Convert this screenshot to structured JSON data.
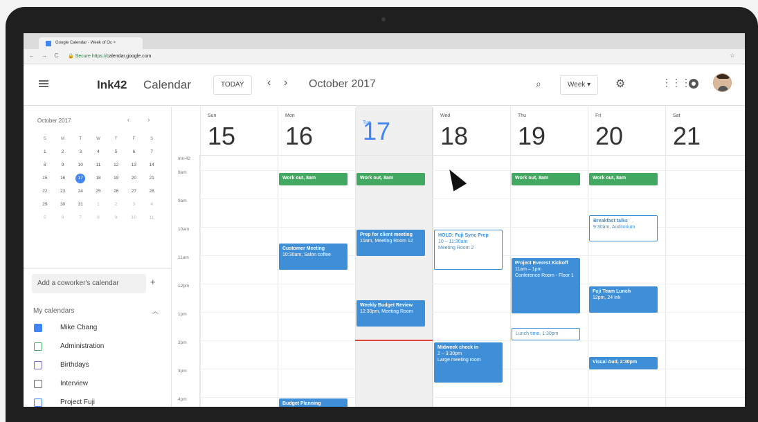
{
  "browser": {
    "tab_title": "Google Calendar - Week of Oc ×",
    "secure": "Secure",
    "url_prefix": "https://",
    "url_host": "calendar.google.com"
  },
  "header": {
    "brand": "Ink42",
    "app": "Calendar",
    "today_btn": "TODAY",
    "period": "October 2017",
    "view": "Week ▾"
  },
  "sidebar": {
    "mini_title": "October 2017",
    "mini_nav": "‹ ›",
    "weekday_heads": [
      "S",
      "M",
      "T",
      "W",
      "T",
      "F",
      "S"
    ],
    "days": [
      [
        "1",
        "2",
        "3",
        "4",
        "5",
        "6",
        "7"
      ],
      [
        "8",
        "9",
        "10",
        "11",
        "12",
        "13",
        "14"
      ],
      [
        "15",
        "16",
        "17",
        "18",
        "19",
        "20",
        "21"
      ],
      [
        "22",
        "23",
        "24",
        "25",
        "26",
        "27",
        "28"
      ],
      [
        "29",
        "30",
        "31",
        "1",
        "2",
        "3",
        "4"
      ],
      [
        "5",
        "6",
        "7",
        "8",
        "9",
        "10",
        "11"
      ]
    ],
    "add_placeholder": "Add a coworker's calendar",
    "my_calendars": "My calendars",
    "calendars": [
      "Mike Chang",
      "Administration",
      "Birthdays",
      "Interview",
      "Project Fuji"
    ]
  },
  "week": {
    "time_zone": "Ink-42",
    "times": [
      "8am",
      "9am",
      "10am",
      "11am",
      "12pm",
      "1pm",
      "2pm",
      "3pm",
      "4pm"
    ],
    "days": [
      {
        "dow": "Sun",
        "dom": "15"
      },
      {
        "dow": "Mon",
        "dom": "16"
      },
      {
        "dow": "Tue",
        "dom": "17"
      },
      {
        "dow": "Wed",
        "dom": "18"
      },
      {
        "dow": "Thu",
        "dom": "19"
      },
      {
        "dow": "Fri",
        "dom": "20"
      },
      {
        "dow": "Sat",
        "dom": "21"
      }
    ],
    "events": {
      "mon_workout": "Work out, 8am",
      "tue_workout": "Work out, 8am",
      "thu_workout": "Work out, 8am",
      "fri_workout": "Work out, 8am",
      "fri_breakfast_title": "Breakfast talks",
      "fri_breakfast_sub": "9:30am, Auditorium",
      "tue_prep_title": "Prep for client meeting",
      "tue_prep_sub": "10am, Meeting Room 12",
      "wed_hold_title": "HOLD: Fuji Sync Prep",
      "wed_hold_time": "10 – 11:30am",
      "wed_hold_room": "Meeting Room 2",
      "mon_customer_title": "Customer Meeting",
      "mon_customer_sub": "10:30am, Salon coffee",
      "thu_everest_title": "Project Everest Kickoff",
      "thu_everest_time": "11am – 1pm",
      "thu_everest_room": "Conference Room - Floor 1",
      "fri_fuji_title": "Fuji Team Lunch",
      "fri_fuji_sub": "12pm, 24 Ink",
      "tue_budget_title": "Weekly Budget Review",
      "tue_budget_sub": "12:30pm, Meeting Room",
      "thu_lunch": "Lunch time, 1:30pm",
      "wed_midweek_title": "Midweek check in",
      "wed_midweek_time": "2 – 3:30pm",
      "wed_midweek_room": "Large meeting room",
      "fri_visual": "Visual Aud, 2:30pm",
      "mon_budget_planning": "Budget Planning"
    }
  }
}
